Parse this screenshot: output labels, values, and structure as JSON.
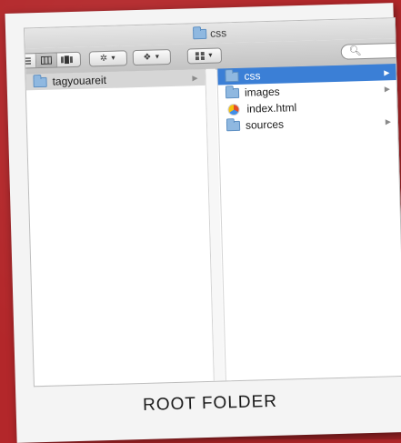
{
  "window": {
    "title": "css"
  },
  "toolbar": {
    "search_placeholder": ""
  },
  "columns": {
    "left": [
      {
        "name": "tagyouareit",
        "kind": "folder",
        "has_children": true,
        "state": "parent-selected"
      }
    ],
    "right": [
      {
        "name": "css",
        "kind": "folder",
        "has_children": true,
        "state": "selected"
      },
      {
        "name": "images",
        "kind": "folder",
        "has_children": true,
        "state": "normal"
      },
      {
        "name": "index.html",
        "kind": "html-file",
        "has_children": false,
        "state": "normal"
      },
      {
        "name": "sources",
        "kind": "folder",
        "has_children": true,
        "state": "normal"
      }
    ]
  },
  "caption": "ROOT FOLDER",
  "colors": {
    "background": "#b3272a",
    "selection": "#3b7fd6",
    "folder": "#8fb8e0"
  },
  "icons": {
    "title_folder": "folder-icon",
    "search": "search-icon",
    "action": "gear-icon",
    "dropbox": "dropbox-icon",
    "arrange": "grid-icon"
  }
}
